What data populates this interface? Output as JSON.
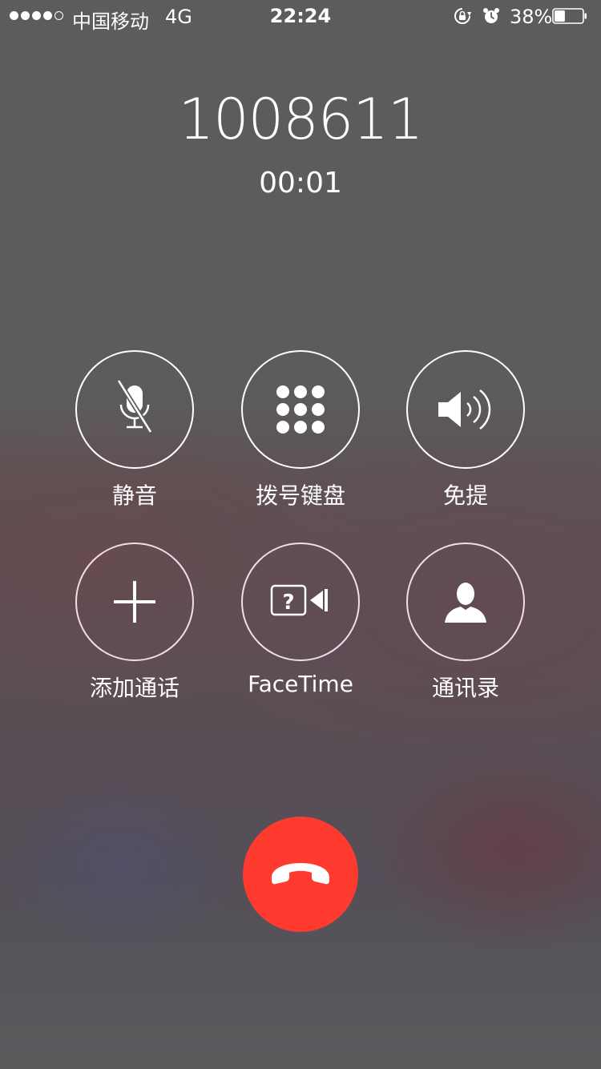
{
  "status_bar": {
    "signal_bars_filled": 4,
    "signal_bars_total": 5,
    "carrier": "中国移动",
    "network": "4G",
    "time": "22:24",
    "battery_percent": "38%",
    "battery_level": 0.38,
    "icons": [
      "rotation-lock-icon",
      "alarm-icon",
      "battery-icon"
    ]
  },
  "call": {
    "number": "1008611",
    "duration": "00:01"
  },
  "controls": {
    "mute": {
      "label": "静音",
      "icon": "microphone-muted-icon"
    },
    "keypad": {
      "label": "拨号键盘",
      "icon": "keypad-icon"
    },
    "speaker": {
      "label": "免提",
      "icon": "speaker-icon"
    },
    "add_call": {
      "label": "添加通话",
      "icon": "plus-icon"
    },
    "facetime": {
      "label": "FaceTime",
      "icon": "facetime-question-icon",
      "icon_text": "?"
    },
    "contacts": {
      "label": "通讯录",
      "icon": "contact-silhouette-icon"
    }
  },
  "end_call": {
    "icon": "hang-up-phone-icon",
    "color": "#ff3b30"
  }
}
